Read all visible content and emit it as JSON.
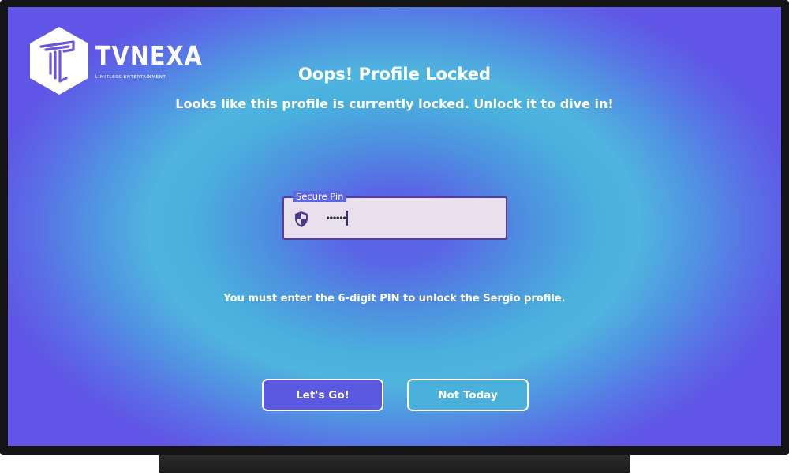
{
  "brand": {
    "name": "TVNEXA",
    "tagline": "LIMITLESS ENTERTAINMENT"
  },
  "lock_screen": {
    "title": "Oops! Profile Locked",
    "subtitle": "Looks like this profile is currently locked. Unlock it to dive in!",
    "hint": "You must enter the 6-digit PIN to unlock the Sergio profile."
  },
  "pin_field": {
    "label": "Secure Pin",
    "masked_value": "••••••",
    "icon": "shield-icon"
  },
  "buttons": {
    "primary_label": "Let's Go!",
    "secondary_label": "Not Today"
  },
  "colors": {
    "primary_button": "#5b58e1",
    "secondary_button": "#4ab0dc",
    "field_background": "#e9e0ee",
    "field_border": "#5a3a9a"
  }
}
